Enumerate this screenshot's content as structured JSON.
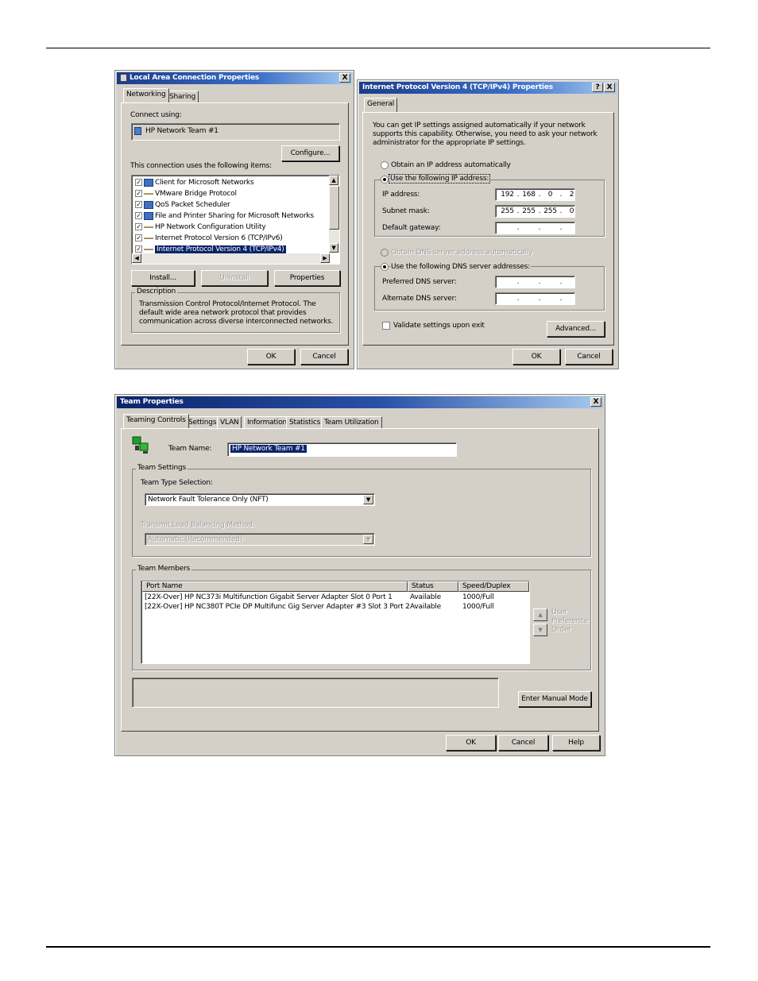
{
  "lac": {
    "title": "Local Area Connection Properties",
    "close": "X",
    "tabs": [
      "Networking",
      "Sharing"
    ],
    "connect_using_label": "Connect using:",
    "adapter": "HP Network Team #1",
    "configure": "Configure...",
    "items_label": "This connection uses the following items:",
    "items": [
      {
        "label": "Client for Microsoft Networks",
        "icon": "network-client-icon",
        "checked": true
      },
      {
        "label": "VMware Bridge Protocol",
        "icon": "protocol-icon",
        "checked": true
      },
      {
        "label": "QoS Packet Scheduler",
        "icon": "service-icon",
        "checked": true
      },
      {
        "label": "File and Printer Sharing for Microsoft Networks",
        "icon": "sharing-icon",
        "checked": true
      },
      {
        "label": "HP Network Configuration Utility",
        "icon": "protocol-icon",
        "checked": true
      },
      {
        "label": "Internet Protocol Version 6 (TCP/IPv6)",
        "icon": "protocol-icon",
        "checked": true
      },
      {
        "label": "Internet Protocol Version 4 (TCP/IPv4)",
        "icon": "protocol-icon",
        "checked": true
      }
    ],
    "install": "Install...",
    "uninstall": "Uninstall",
    "properties": "Properties",
    "description_label": "Description",
    "description": "Transmission Control Protocol/Internet Protocol. The default wide area network protocol that provides communication across diverse interconnected networks.",
    "ok": "OK",
    "cancel": "Cancel"
  },
  "ipv4": {
    "title": "Internet Protocol Version 4 (TCP/IPv4) Properties",
    "help": "?",
    "close": "X",
    "tab": "General",
    "intro": "You can get IP settings assigned automatically if your network supports this capability. Otherwise, you need to ask your network administrator for the appropriate IP settings.",
    "obtain_auto": "Obtain an IP address automatically",
    "use_following": "Use the following IP address:",
    "ip_label": "IP address:",
    "ip": [
      "192",
      "168",
      "0",
      "2"
    ],
    "subnet_label": "Subnet mask:",
    "subnet": [
      "255",
      "255",
      "255",
      "0"
    ],
    "gateway_label": "Default gateway:",
    "dns_auto": "Obtain DNS server address automatically",
    "dns_following": "Use the following DNS server addresses:",
    "preferred_dns_label": "Preferred DNS server:",
    "alternate_dns_label": "Alternate DNS server:",
    "dot": ".",
    "validate": "Validate settings upon exit",
    "advanced": "Advanced...",
    "ok": "OK",
    "cancel": "Cancel"
  },
  "team": {
    "title": "Team Properties",
    "close": "X",
    "tabs": [
      "Teaming Controls",
      "Settings",
      "VLAN",
      "Information",
      "Statistics",
      "Team Utilization"
    ],
    "team_name_label": "Team Name:",
    "team_name": "HP Network Team #1",
    "team_settings": "Team Settings",
    "type_label": "Team Type Selection:",
    "type_value": "Network Fault Tolerance Only (NFT)",
    "lb_label": "Transmit Load Balancing Method:",
    "lb_value": "Automatic (Recommended)",
    "members_label": "Team Members",
    "columns": [
      "Port Name",
      "Status",
      "Speed/Duplex"
    ],
    "rows": [
      [
        "[22X-Over] HP NC373i Multifunction Gigabit Server Adapter Slot 0 Port 1",
        "Available",
        "1000/Full"
      ],
      [
        "[22X-Over] HP NC380T PCIe DP Multifunc Gig Server Adapter #3 Slot 3 Port 2",
        "Available",
        "1000/Full"
      ]
    ],
    "user_pref": [
      "User",
      "Preference",
      "Order"
    ],
    "manual_mode": "Enter Manual Mode",
    "ok": "OK",
    "cancel": "Cancel",
    "help": "Help"
  },
  "colors": {
    "title_start": "#1b3c8c",
    "title_end": "#a6caf0",
    "dialog": "#d4d0c8",
    "selection": "#0a246a"
  }
}
